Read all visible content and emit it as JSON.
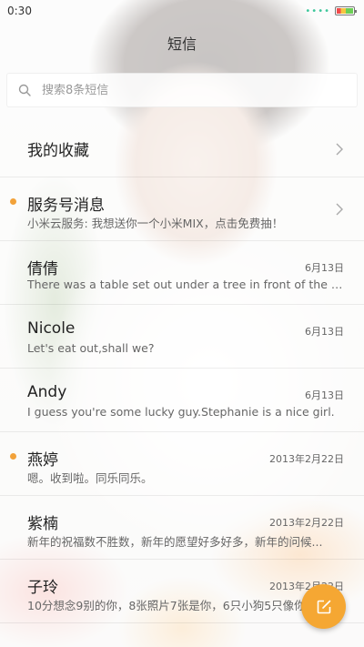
{
  "status_bar": {
    "time": "0:30",
    "signal_dots": "••••"
  },
  "header": {
    "title": "短信"
  },
  "search": {
    "placeholder": "搜索8条短信"
  },
  "colors": {
    "accent": "#f5a733",
    "unread_dot": "#f2a23a"
  },
  "items": [
    {
      "name": "我的收藏",
      "type": "folder"
    },
    {
      "name": "服务号消息",
      "preview": "小米云服务: 我想送你一个小米MIX，点击免费抽！",
      "unread": true,
      "type": "folder"
    },
    {
      "name": "倩倩",
      "date": "6月13日",
      "preview": "There was a table set out under a tree in front of the ho..."
    },
    {
      "name": "Nicole",
      "date": "6月13日",
      "preview": "Let's eat out,shall we?"
    },
    {
      "name": "Andy",
      "date": "6月13日",
      "preview": "I guess you're some lucky guy.Stephanie is a nice girl."
    },
    {
      "name": "燕婷",
      "date": "2013年2月22日",
      "preview": "嗯。收到啦。同乐同乐。",
      "unread": true
    },
    {
      "name": "紫楠",
      "date": "2013年2月22日",
      "preview": "新年的祝福数不胜数，新年的愿望好多好多，新年的问候..."
    },
    {
      "name": "子玲",
      "date": "2013年2月22日",
      "preview": "10分想念9别的你，8张照片7张是你，6只小狗5只像你..."
    }
  ],
  "fab": {
    "icon": "compose-icon"
  }
}
